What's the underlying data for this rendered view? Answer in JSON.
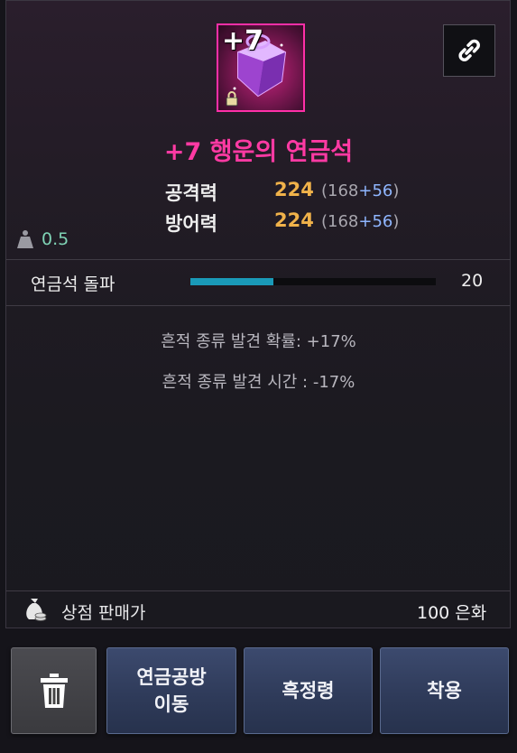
{
  "item": {
    "enhance_label": "+7",
    "name": "+7 행운의 연금석",
    "stats": [
      {
        "label": "공격력",
        "value": "224",
        "base": "168",
        "bonus": "+56"
      },
      {
        "label": "방어력",
        "value": "224",
        "base": "168",
        "bonus": "+56"
      }
    ],
    "weight": "0.5"
  },
  "breakthrough": {
    "label": "연금석 돌파",
    "value": "20",
    "progress_fraction": 0.34
  },
  "effects": [
    "흔적 종류 발견 확률: +17%",
    "흔적 종류 발견 시간 : -17%"
  ],
  "shop": {
    "label": "상점 판매가",
    "value": "100 은화"
  },
  "buttons": {
    "move_line1": "연금공방",
    "move_line2": "이동",
    "black": "흑정령",
    "equip": "착용"
  },
  "colors": {
    "item_name": "#ff3aa3",
    "stat_value": "#f0b24a",
    "bar": "#1a9ab8",
    "frame": "#ff2fa8"
  },
  "icons": {
    "link": "link-icon",
    "trash": "trash-icon",
    "weight": "weight-icon",
    "money_bag": "money-bag-icon",
    "lock": "lock-icon"
  }
}
